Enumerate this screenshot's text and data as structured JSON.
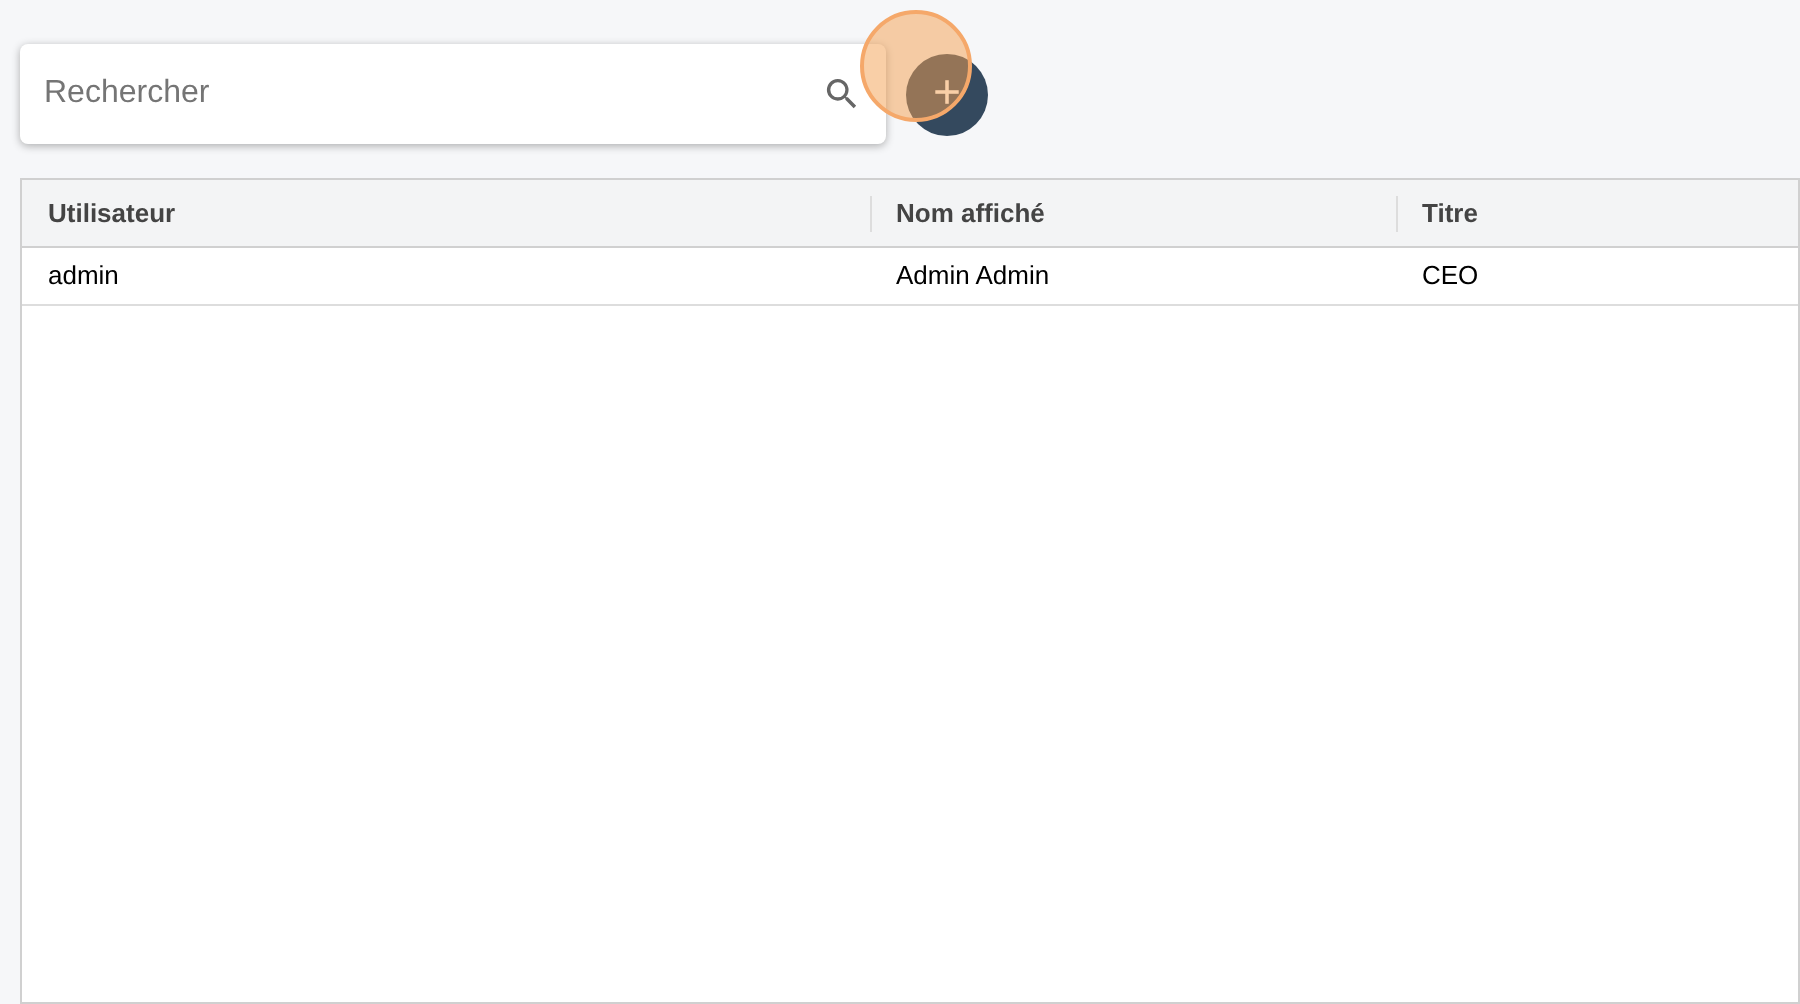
{
  "search": {
    "placeholder": "Rechercher"
  },
  "add_button": {
    "label": "+"
  },
  "table": {
    "columns": [
      "Utilisateur",
      "Nom affiché",
      "Titre"
    ],
    "rows": [
      [
        "admin",
        "Admin Admin",
        "CEO"
      ]
    ]
  }
}
